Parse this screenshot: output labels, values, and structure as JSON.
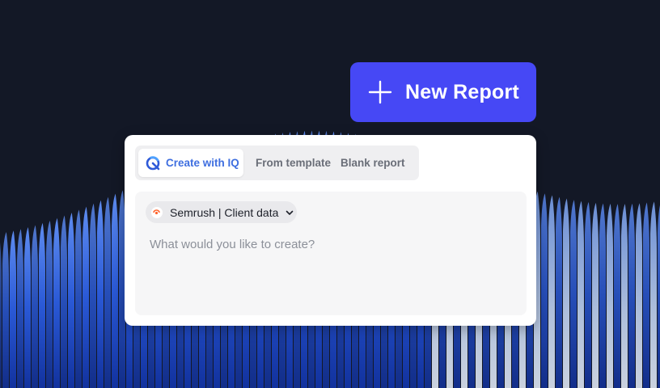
{
  "new_report": {
    "label": "New Report",
    "icon": "plus-icon",
    "color": "#4648f5"
  },
  "tabs": [
    {
      "label": "Create with IQ",
      "icon": "iq-logo-icon",
      "active": true,
      "color": "#3f6fe0"
    },
    {
      "label": "From template",
      "active": false
    },
    {
      "label": "Blank report",
      "active": false
    }
  ],
  "source_selector": {
    "label": "Semrush | Client data",
    "icon": "semrush-icon",
    "caret": "chevron-down-icon"
  },
  "prompt": {
    "placeholder": "What would you like to create?",
    "value": ""
  },
  "colors": {
    "background": "#131826",
    "accent_blue": "#2f5bd8"
  }
}
